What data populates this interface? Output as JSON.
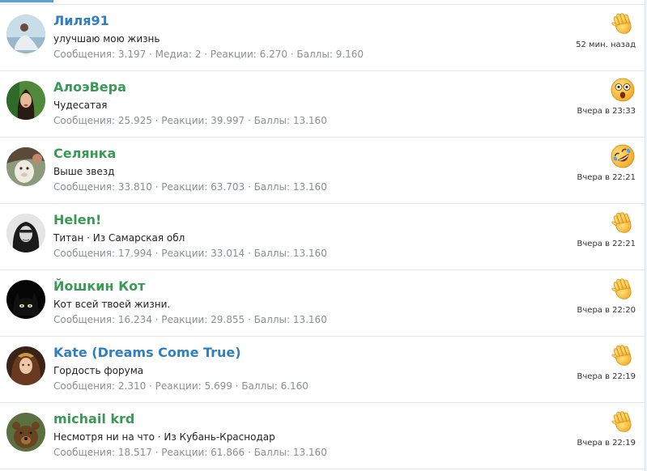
{
  "members": [
    {
      "name": "Лиля91",
      "name_color": "blue",
      "title": "улучшаю мою жизнь",
      "stats": "Сообщения: 3.197 · Медиа: 2 · Реакции: 6.270 · Баллы: 9.160",
      "reaction_icon": "wave-hand-icon",
      "time": "52 мин. назад"
    },
    {
      "name": "АлоэВера",
      "name_color": "green",
      "title": "Чудесатая",
      "stats": "Сообщения: 25.925 · Реакции: 39.997 · Баллы: 13.160",
      "reaction_icon": "astonished-face-icon",
      "time": "Вчера в 23:33"
    },
    {
      "name": "Селянка",
      "name_color": "green",
      "title": "Выше звезд",
      "stats": "Сообщения: 33.810 · Реакции: 63.703 · Баллы: 13.160",
      "reaction_icon": "rolling-laughing-face-icon",
      "time": "Вчера в 22:21"
    },
    {
      "name": "Helen!",
      "name_color": "green",
      "title": "Титан · Из Самарская обл",
      "stats": "Сообщения: 17.994 · Реакции: 33.014 · Баллы: 13.160",
      "reaction_icon": "wave-hand-icon",
      "time": "Вчера в 22:21"
    },
    {
      "name": "Йошкин Кот",
      "name_color": "green",
      "title": "Кот всей твоей жизни.",
      "stats": "Сообщения: 16.234 · Реакции: 29.855 · Баллы: 13.160",
      "reaction_icon": "wave-hand-icon",
      "time": "Вчера в 22:20"
    },
    {
      "name": "Kate (Dreams Come True)",
      "name_color": "blue",
      "title": "Гордость форума",
      "stats": "Сообщения: 2.310 · Реакции: 5.699 · Баллы: 6.160",
      "reaction_icon": "wave-hand-icon",
      "time": "Вчера в 22:19"
    },
    {
      "name": "michail krd",
      "name_color": "green",
      "title": "Несмотря ни на что · Из Кубань-Краснодар",
      "stats": "Сообщения: 18.517 · Реакции: 61.866 · Баллы: 13.160",
      "reaction_icon": "wave-hand-icon",
      "time": "Вчера в 22:19"
    }
  ],
  "colors": {
    "name_green": "#3a9a55",
    "name_blue": "#2f7fc1",
    "stats_gray": "#8a8f96",
    "tab_accent": "#5a9fd4"
  }
}
